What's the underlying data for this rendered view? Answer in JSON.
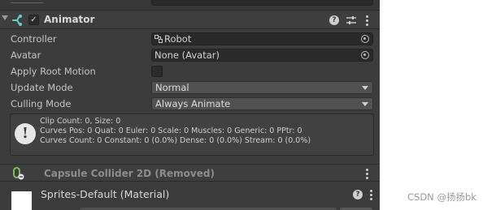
{
  "animator": {
    "title": "Animator",
    "enabled_check": "✓",
    "properties": {
      "controller": {
        "label": "Controller",
        "value": "Robot"
      },
      "avatar": {
        "label": "Avatar",
        "value": "None (Avatar)"
      },
      "apply_root_motion": {
        "label": "Apply Root Motion",
        "checked": false
      },
      "update_mode": {
        "label": "Update Mode",
        "value": "Normal"
      },
      "culling_mode": {
        "label": "Culling Mode",
        "value": "Always Animate"
      }
    },
    "info": {
      "icon": "!",
      "lines": [
        "Clip Count: 0, Size: 0",
        "Curves Pos: 0 Quat: 0 Euler: 0 Scale: 0 Muscles: 0 Generic: 0 PPtr: 0",
        "Curves Count: 0 Constant: 0 (0.0%) Dense: 0 (0.0%) Stream: 0 (0.0%)"
      ]
    }
  },
  "capsule_collider": {
    "title": "Capsule Collider 2D (Removed)"
  },
  "material": {
    "title": "Sprites-Default (Material)"
  },
  "watermark": "CSDN @扬扬bk",
  "icons": {
    "animator": "animator-icon",
    "help": "help-icon",
    "presets": "presets-icon",
    "menu": "kebab-menu-icon",
    "controller": "animator-controller-icon",
    "object_picker": "object-picker-icon",
    "info": "info-icon",
    "capsule_collider": "capsule-collider-icon"
  },
  "colors": {
    "panel_bg": "#3c3c3c",
    "field_bg": "#2a2a2a",
    "dropdown_bg": "#515151",
    "text": "#c4c4c4",
    "removed_text": "#8d8d8d"
  }
}
